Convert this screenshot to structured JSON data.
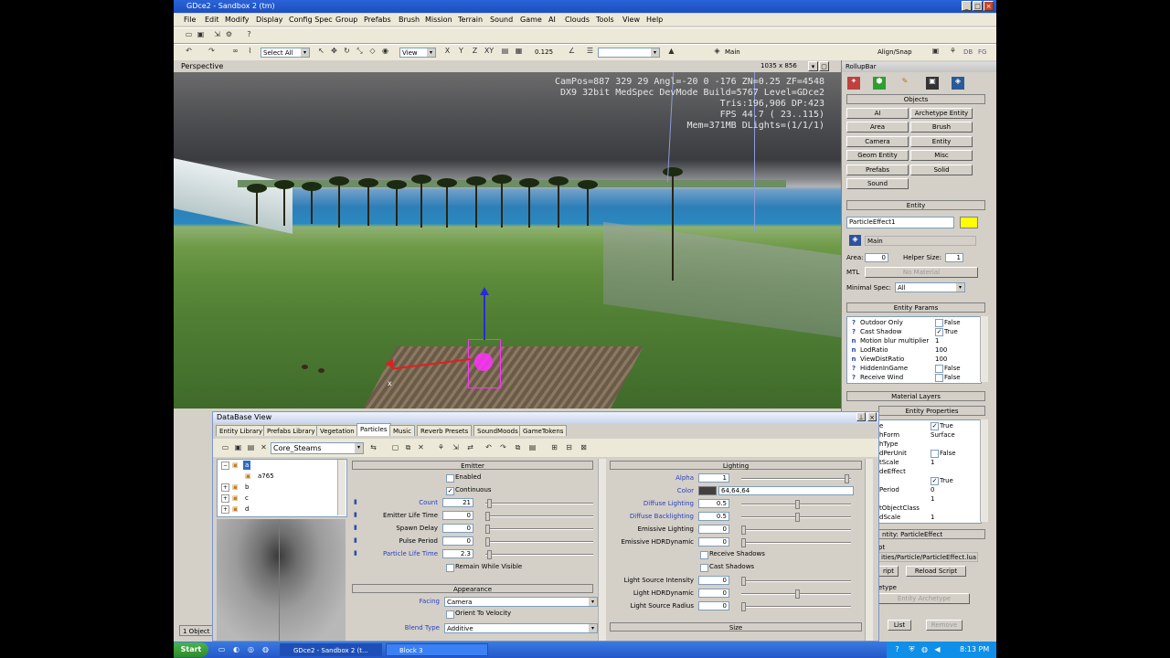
{
  "window": {
    "title": "GDce2 - Sandbox 2 (tm)",
    "min": "_",
    "max": "□",
    "close": "×"
  },
  "menu": [
    "File",
    "Edit",
    "Modify",
    "Display",
    "Config Spec",
    "Group",
    "Prefabs",
    "Brush",
    "Mission",
    "Terrain",
    "Sound",
    "Game",
    "AI",
    "Clouds",
    "Tools",
    "View",
    "Help"
  ],
  "toolbar": {
    "select_filter": "Select All",
    "ref_frame": "View",
    "axis": {
      "x": "X",
      "y": "Y",
      "z": "Z",
      "xy": "XY"
    },
    "grid_value": "0.125",
    "layer": "Main",
    "align_snap": "Align/Snap",
    "db_label": "DB",
    "fg_label": "FG"
  },
  "viewport": {
    "name": "Perspective",
    "resolution": "1035 x 856",
    "hud": [
      "CamPos=887 329   29 Angl=-20   0 -176 ZN=0.25 ZF=4548",
      "DX9 32bit MedSpec DevMode Build=5767 Level=GDce2",
      "Tris:196,906  DP:423",
      "FPS  44.7 ( 23..115)",
      "Mem=371MB DLights=(1/1/1)"
    ],
    "axis_x": "x"
  },
  "rollup": {
    "title": "RollupBar",
    "objects_header": "Objects",
    "object_buttons": [
      "AI",
      "Archetype Entity",
      "Area",
      "Brush",
      "Camera",
      "Entity",
      "Geom Entity",
      "Misc",
      "Prefabs",
      "Solid",
      "Sound"
    ],
    "entity_header": "Entity",
    "entity_name": "ParticleEffect1",
    "entity_color": "#ffff00",
    "layer": "Main",
    "area_label": "Area:",
    "area_value": "0",
    "helper_label": "Helper Size:",
    "helper_value": "1",
    "mtl_label": "MTL",
    "mtl_button": "No Material",
    "spec_label": "Minimal Spec:",
    "spec_value": "All",
    "params_header": "Entity Params",
    "params": [
      {
        "icon": "?",
        "name": "Outdoor Only",
        "checked": false,
        "value": "False"
      },
      {
        "icon": "?",
        "name": "Cast Shadow",
        "checked": true,
        "value": "True"
      },
      {
        "icon": "n",
        "name": "Motion blur multiplier",
        "value": "1"
      },
      {
        "icon": "n",
        "name": "LodRatio",
        "value": "100"
      },
      {
        "icon": "n",
        "name": "ViewDistRatio",
        "value": "100"
      },
      {
        "icon": "?",
        "name": "HiddenInGame",
        "checked": false,
        "value": "False"
      },
      {
        "icon": "?",
        "name": "Receive Wind",
        "checked": false,
        "value": "False"
      }
    ],
    "material_header": "Material Layers",
    "props_header": "Entity Properties",
    "props": [
      {
        "name": "e",
        "checked": true,
        "value": "True"
      },
      {
        "name": "hForm",
        "value": "Surface"
      },
      {
        "name": "hType",
        "value": ""
      },
      {
        "name": "dPerUnit",
        "checked": false,
        "value": "False"
      },
      {
        "name": "tScale",
        "value": "1"
      },
      {
        "name": "deEffect",
        "value": ""
      },
      {
        "name": "",
        "checked": true,
        "value": "True"
      },
      {
        "name": "Period",
        "value": "0"
      },
      {
        "name": "",
        "value": "1"
      },
      {
        "name": "tObjectClass",
        "value": ""
      },
      {
        "name": "dScale",
        "value": "1"
      }
    ],
    "entity_type_header": "ntity: ParticleEffect",
    "script_label": "pt",
    "script_path": "ities/Particle/ParticleEffect.lua",
    "edit_script": "ript",
    "reload_script": "Reload Script",
    "archetype_label": "etype",
    "archetype_button": "Entity Archetype",
    "list_button": "List",
    "remove_button": "Remove"
  },
  "dbview": {
    "title": "DataBase View",
    "tabs": [
      "Entity Library",
      "Prefabs Library",
      "Vegetation",
      "Particles",
      "Music",
      "Reverb Presets",
      "SoundMoods",
      "GameTokens"
    ],
    "active_tab": "Particles",
    "library": "Core_Steams",
    "tree": [
      {
        "label": "a",
        "level": 0,
        "selected": true
      },
      {
        "label": "a765",
        "level": 1
      },
      {
        "label": "b",
        "level": 0
      },
      {
        "label": "c",
        "level": 0
      },
      {
        "label": "d",
        "level": 0
      }
    ],
    "emitter": {
      "header": "Emitter",
      "enabled": "Enabled",
      "enabled_checked": false,
      "continuous": "Continuous",
      "continuous_checked": true,
      "rows": [
        {
          "label": "Count",
          "value": "21",
          "blue": true,
          "pos": 0.02
        },
        {
          "label": "Emitter Life Time",
          "value": "0",
          "blue": false,
          "pos": 0
        },
        {
          "label": "Spawn Delay",
          "value": "0",
          "blue": false,
          "pos": 0
        },
        {
          "label": "Pulse Period",
          "value": "0",
          "blue": false,
          "pos": 0
        },
        {
          "label": "Particle Life Time",
          "value": "2.3",
          "blue": true,
          "pos": 0.02
        }
      ],
      "remain": "Remain While Visible"
    },
    "appearance": {
      "header": "Appearance",
      "facing_label": "Facing",
      "facing_value": "Camera",
      "orient": "Orient To Velocity",
      "blend_label": "Blend Type",
      "blend_value": "Additive"
    },
    "lighting": {
      "header": "Lighting",
      "rows": [
        {
          "label": "Alpha",
          "value": "1",
          "blue": true,
          "pos": 0.97
        },
        {
          "label": "Color",
          "value": "64,64,64",
          "blue": true,
          "color": "#404040"
        },
        {
          "label": "Diffuse Lighting",
          "value": "0.5",
          "blue": true,
          "pos": 0.5
        },
        {
          "label": "Diffuse Backlighting",
          "value": "0.5",
          "blue": true,
          "pos": 0.5
        },
        {
          "label": "Emissive Lighting",
          "value": "0",
          "blue": false,
          "pos": 0
        },
        {
          "label": "Emissive HDRDynamic",
          "value": "0",
          "blue": false,
          "pos": 0
        }
      ],
      "receive_shadows": "Receive Shadows",
      "cast_shadows": "Cast Shadows",
      "rows2": [
        {
          "label": "Light Source Intensity",
          "value": "0",
          "pos": 0
        },
        {
          "label": "Light HDRDynamic",
          "value": "0",
          "pos": 0.5
        },
        {
          "label": "Light Source Radius",
          "value": "0",
          "pos": 0
        }
      ]
    },
    "size_header": "Size"
  },
  "status": {
    "objects": "1 Object"
  },
  "taskbar": {
    "start": "Start",
    "tasks": [
      "GDce2 - Sandbox 2 (t...",
      "Block 3"
    ],
    "clock": "8:13 PM"
  }
}
